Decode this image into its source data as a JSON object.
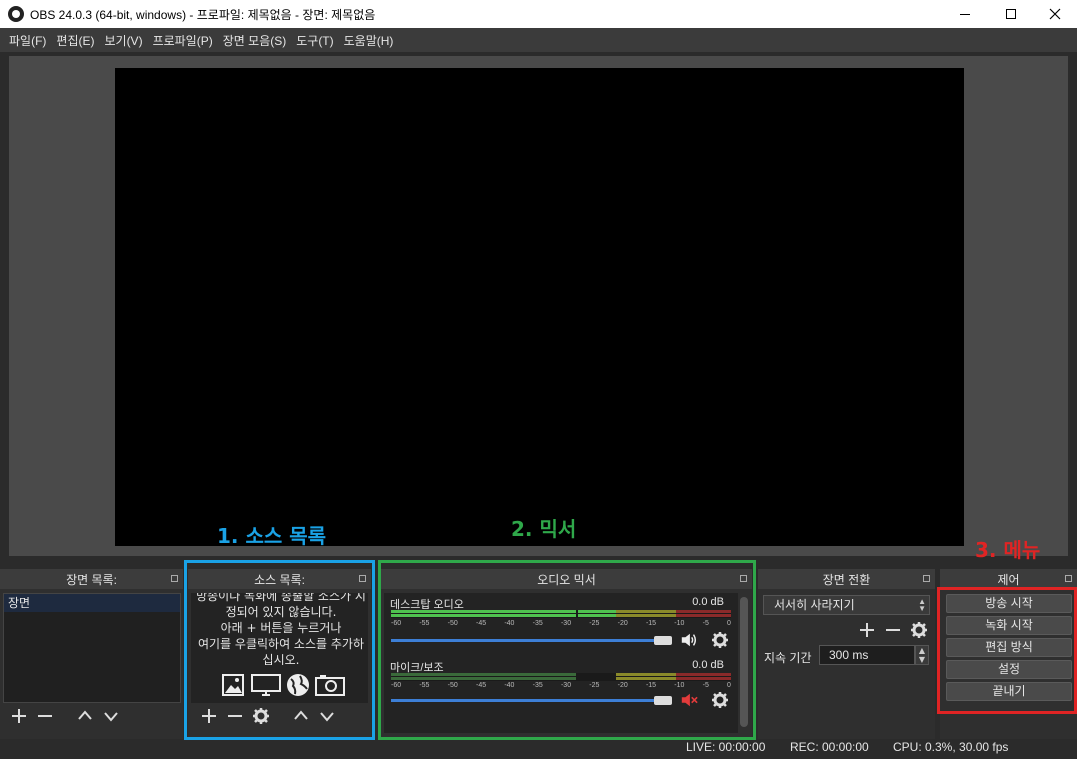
{
  "window": {
    "title": "OBS 24.0.3 (64-bit, windows) - 프로파일: 제목없음 - 장면: 제목없음"
  },
  "menu": [
    "파일(F)",
    "편집(E)",
    "보기(V)",
    "프로파일(P)",
    "장면 모음(S)",
    "도구(T)",
    "도움말(H)"
  ],
  "annotations": {
    "sources": "1. 소스 목록",
    "mixer": "2. 믹서",
    "menu": "3. 메뉴"
  },
  "scenes": {
    "header": "장면 목록:",
    "items": [
      "장면"
    ]
  },
  "sources": {
    "header": "소스 목록:",
    "empty_lines": [
      "방송이나 녹화에 송출할 소스가 지",
      "정되어 있지 않습니다.",
      "아래 + 버튼을 누르거나",
      "여기를 우클릭하여 소스를 추가하",
      "십시오."
    ]
  },
  "mixer": {
    "header": "오디오 믹서",
    "ticks": [
      "-60",
      "-55",
      "-50",
      "-45",
      "-40",
      "-35",
      "-30",
      "-25",
      "-20",
      "-15",
      "-10",
      "-5",
      "0"
    ],
    "channels": [
      {
        "name": "데스크탑 오디오",
        "db": "0.0 dB",
        "muted": false
      },
      {
        "name": "마이크/보조",
        "db": "0.0 dB",
        "muted": true
      }
    ]
  },
  "transitions": {
    "header": "장면 전환",
    "selected": "서서히 사라지기",
    "duration_label": "지속 기간",
    "duration_value": "300 ms"
  },
  "controls": {
    "header": "제어",
    "buttons": [
      "방송 시작",
      "녹화 시작",
      "편집 방식",
      "설정",
      "끝내기"
    ]
  },
  "status": {
    "live": "LIVE: 00:00:00",
    "rec": "REC: 00:00:00",
    "cpu": "CPU: 0.3%, 30.00 fps"
  },
  "colors": {
    "sources_box": "#1aa2e6",
    "mixer_box": "#2fa84a",
    "controls_box": "#e02424"
  }
}
